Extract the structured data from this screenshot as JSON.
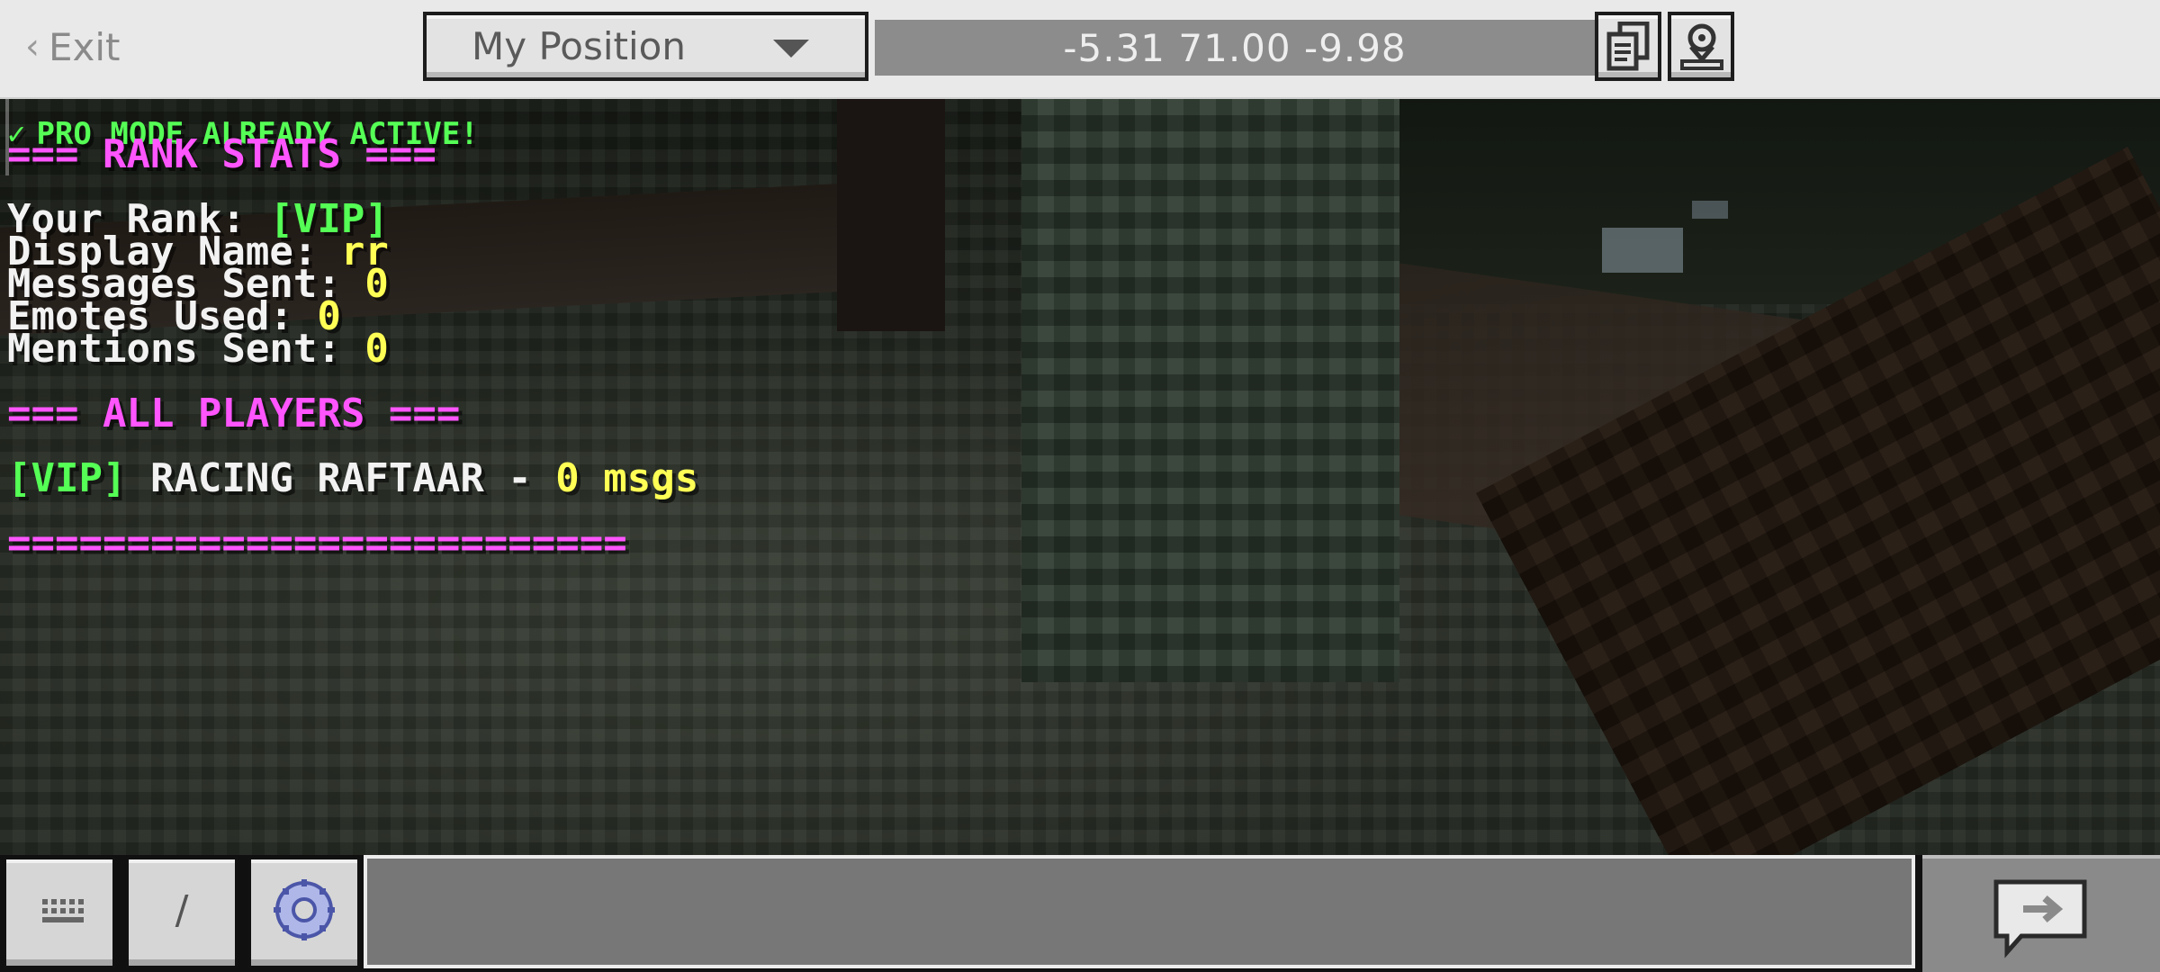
{
  "topbar": {
    "exit_label": "Exit",
    "position_select": "My Position",
    "coordinates": "-5.31 71.00 -9.98"
  },
  "chat": {
    "pro_mode": "PRO MODE ALREADY ACTIVE!",
    "rank_header": "=== RANK STATS ===",
    "your_rank_label": "Your Rank: ",
    "your_rank_value": "[VIP]",
    "display_name_label": "Display Name: ",
    "display_name_value": "rr",
    "messages_sent_label": "Messages Sent: ",
    "messages_sent_value": "0",
    "emotes_used_label": "Emotes Used: ",
    "emotes_used_value": "0",
    "mentions_sent_label": "Mentions Sent: ",
    "mentions_sent_value": "0",
    "players_header": "=== ALL PLAYERS ===",
    "player_rank": "[VIP]",
    "player_name": " RACING RAFTAAR - ",
    "player_count": "0",
    "player_unit": " msgs",
    "divider": "=========================="
  },
  "bottombar": {
    "slash_label": "/",
    "input_value": "",
    "input_placeholder": ""
  },
  "icons": {
    "exit": "chevron-left-icon",
    "dropdown": "caret-down-icon",
    "copy": "copy-coordinates-icon",
    "coords": "coordinates-icon",
    "keyboard": "keyboard-icon",
    "emote": "emote-icon",
    "send": "send-icon",
    "check": "checkmark-icon"
  },
  "colors": {
    "pink": "#ff55ff",
    "green": "#55ff55",
    "yellow": "#ffff55",
    "white": "#f2f2f2"
  }
}
